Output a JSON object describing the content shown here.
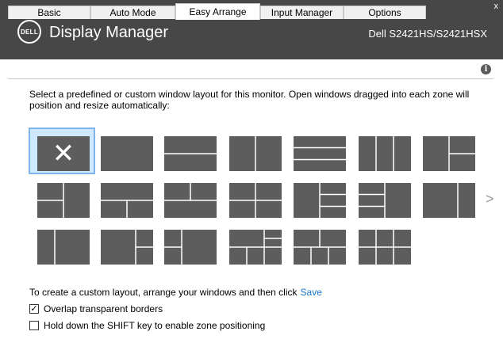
{
  "window": {
    "app_title": "Display Manager",
    "monitor_name": "Dell S2421HS/S2421HSX",
    "close_label": "x",
    "logo_text": "DELL"
  },
  "tabs": [
    {
      "label": "Basic",
      "active": false
    },
    {
      "label": "Auto Mode",
      "active": false
    },
    {
      "label": "Easy Arrange",
      "active": true
    },
    {
      "label": "Input Manager",
      "active": false
    },
    {
      "label": "Options",
      "active": false
    }
  ],
  "info_icon": "i",
  "description": "Select a predefined or custom window layout for this monitor.  Open windows dragged into each zone will position and resize automatically:",
  "layouts": [
    {
      "id": "none",
      "icon": "close-icon",
      "selected": true
    },
    "full",
    "two-rows",
    "two-columns",
    "three-rows",
    "three-columns",
    "left-two-right",
    "two-left-one-right",
    "two-rows-two-columns",
    "top-one-bottom-two",
    "wide-left-two-right",
    "left-three-right",
    "three-left-one-right",
    "right-two-rows",
    "left-one-right-one",
    "narrow-left-two-right",
    "quad-with-center-row",
    "mixed-grid",
    "grid-2x3",
    "grid-2x3-b"
  ],
  "custom_prompt": "To create a custom layout, arrange your windows and then click",
  "save_label": "Save",
  "options": [
    {
      "label": "Overlap transparent borders",
      "checked": true
    },
    {
      "label": "Hold down the SHIFT key to enable zone positioning",
      "checked": false
    }
  ],
  "colors": {
    "titlebar": "#474747",
    "layout_tile": "#5d5d5d",
    "tile_divider": "#ffffff",
    "selection_fill": "#cde8ff",
    "selection_border": "#7eb4ea",
    "link": "#1a73c8"
  }
}
